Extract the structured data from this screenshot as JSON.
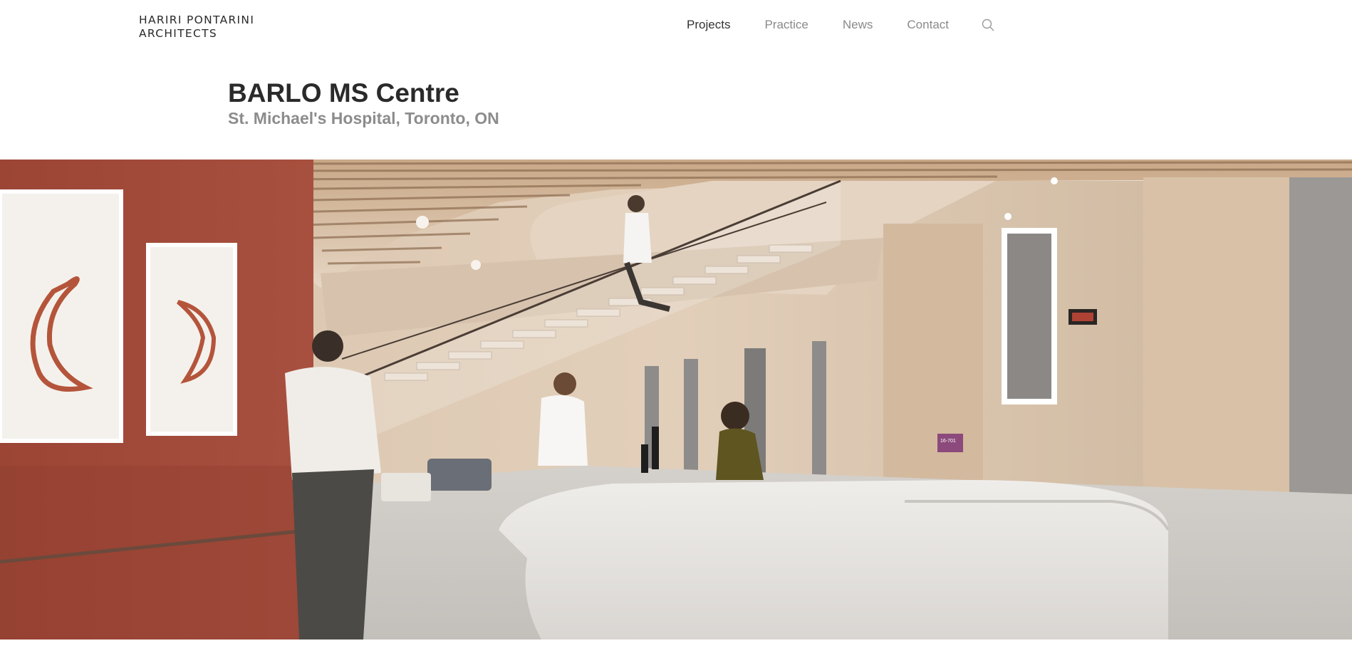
{
  "brand": {
    "line1": "HARIRI PONTARINI",
    "line2": "ARCHITECTS"
  },
  "nav": {
    "items": [
      {
        "label": "Projects",
        "active": true
      },
      {
        "label": "Practice",
        "active": false
      },
      {
        "label": "News",
        "active": false
      },
      {
        "label": "Contact",
        "active": false
      }
    ],
    "search_icon": "search-icon"
  },
  "project": {
    "title": "BARLO MS Centre",
    "location": "St. Michael's Hospital, Toronto, ON"
  },
  "hero_image": {
    "depicts": "hospital-reception-interior",
    "sign_text": "16-701",
    "colors": {
      "accent_wall": "#a24a3b",
      "wood": "#d8c2aa",
      "desk": "#e6e4e1",
      "sign": "#8c4a7c"
    }
  }
}
